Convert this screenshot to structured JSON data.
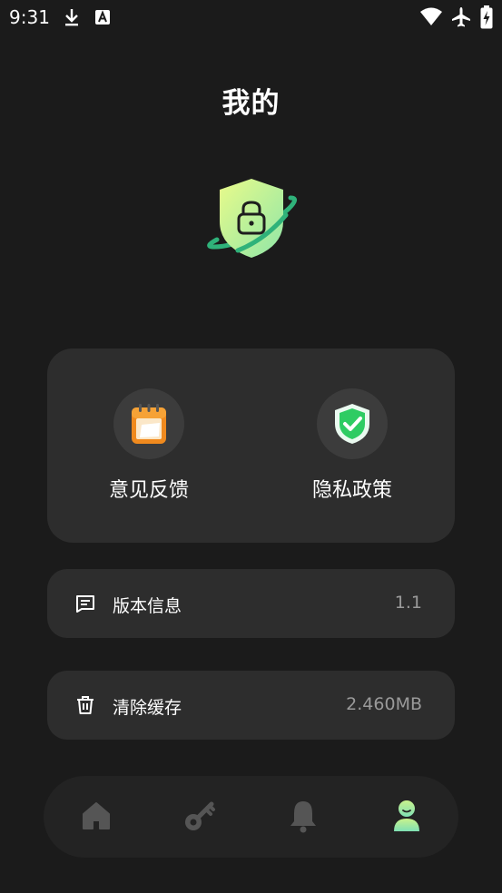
{
  "status_bar": {
    "time": "9:31",
    "icons": [
      "download-icon",
      "text-a-icon",
      "wifi-icon",
      "airplane-icon",
      "battery-charging-icon"
    ]
  },
  "page": {
    "title": "我的"
  },
  "features": [
    {
      "label": "意见反馈",
      "icon": "notepad-icon"
    },
    {
      "label": "隐私政策",
      "icon": "shield-check-icon"
    }
  ],
  "rows": {
    "version": {
      "label": "版本信息",
      "value": "1.1",
      "icon": "message-icon"
    },
    "cache": {
      "label": "清除缓存",
      "value": "2.460MB",
      "icon": "trash-icon"
    }
  },
  "bottom_nav": {
    "items": [
      "home-icon",
      "key-icon",
      "bell-icon",
      "profile-icon"
    ],
    "active": "profile-icon",
    "colors": {
      "inactive": "#555555",
      "active_gradient": [
        "#c9f28c",
        "#7fe0b4"
      ]
    }
  },
  "colors": {
    "background": "#1b1b1b",
    "card": "#2d2d2d",
    "accent_green": "#3ccf73"
  }
}
